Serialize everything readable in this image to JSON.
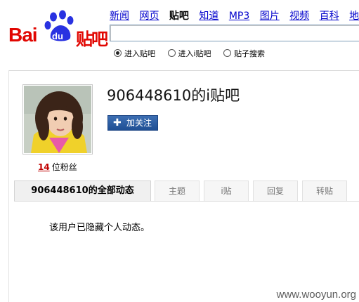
{
  "logo": {
    "bai": "Bai",
    "du": "du",
    "tieba": "贴吧",
    "paw_color": "#2932e1",
    "red": "#e10601"
  },
  "nav": {
    "items": [
      "新闻",
      "网页",
      "贴吧",
      "知道",
      "MP3",
      "图片",
      "视频",
      "百科",
      "地图"
    ],
    "active": "贴吧"
  },
  "search": {
    "value": ""
  },
  "search_options": [
    {
      "label": "进入贴吧",
      "selected": true
    },
    {
      "label": "进入i贴吧",
      "selected": false
    },
    {
      "label": "贴子搜索",
      "selected": false
    }
  ],
  "profile": {
    "title": "906448610的i贴吧",
    "follow_label": "加关注",
    "follow_icon": "plus-icon",
    "fans_count": "14",
    "fans_label": "位粉丝"
  },
  "tabs": [
    {
      "label": "906448610的全部动态",
      "active": true
    },
    {
      "label": "主题",
      "active": false
    },
    {
      "label": "i贴",
      "active": false
    },
    {
      "label": "回复",
      "active": false
    },
    {
      "label": "转贴",
      "active": false
    }
  ],
  "content": {
    "message": "该用户已隐藏个人动态。"
  },
  "watermark": "www.wooyun.org"
}
